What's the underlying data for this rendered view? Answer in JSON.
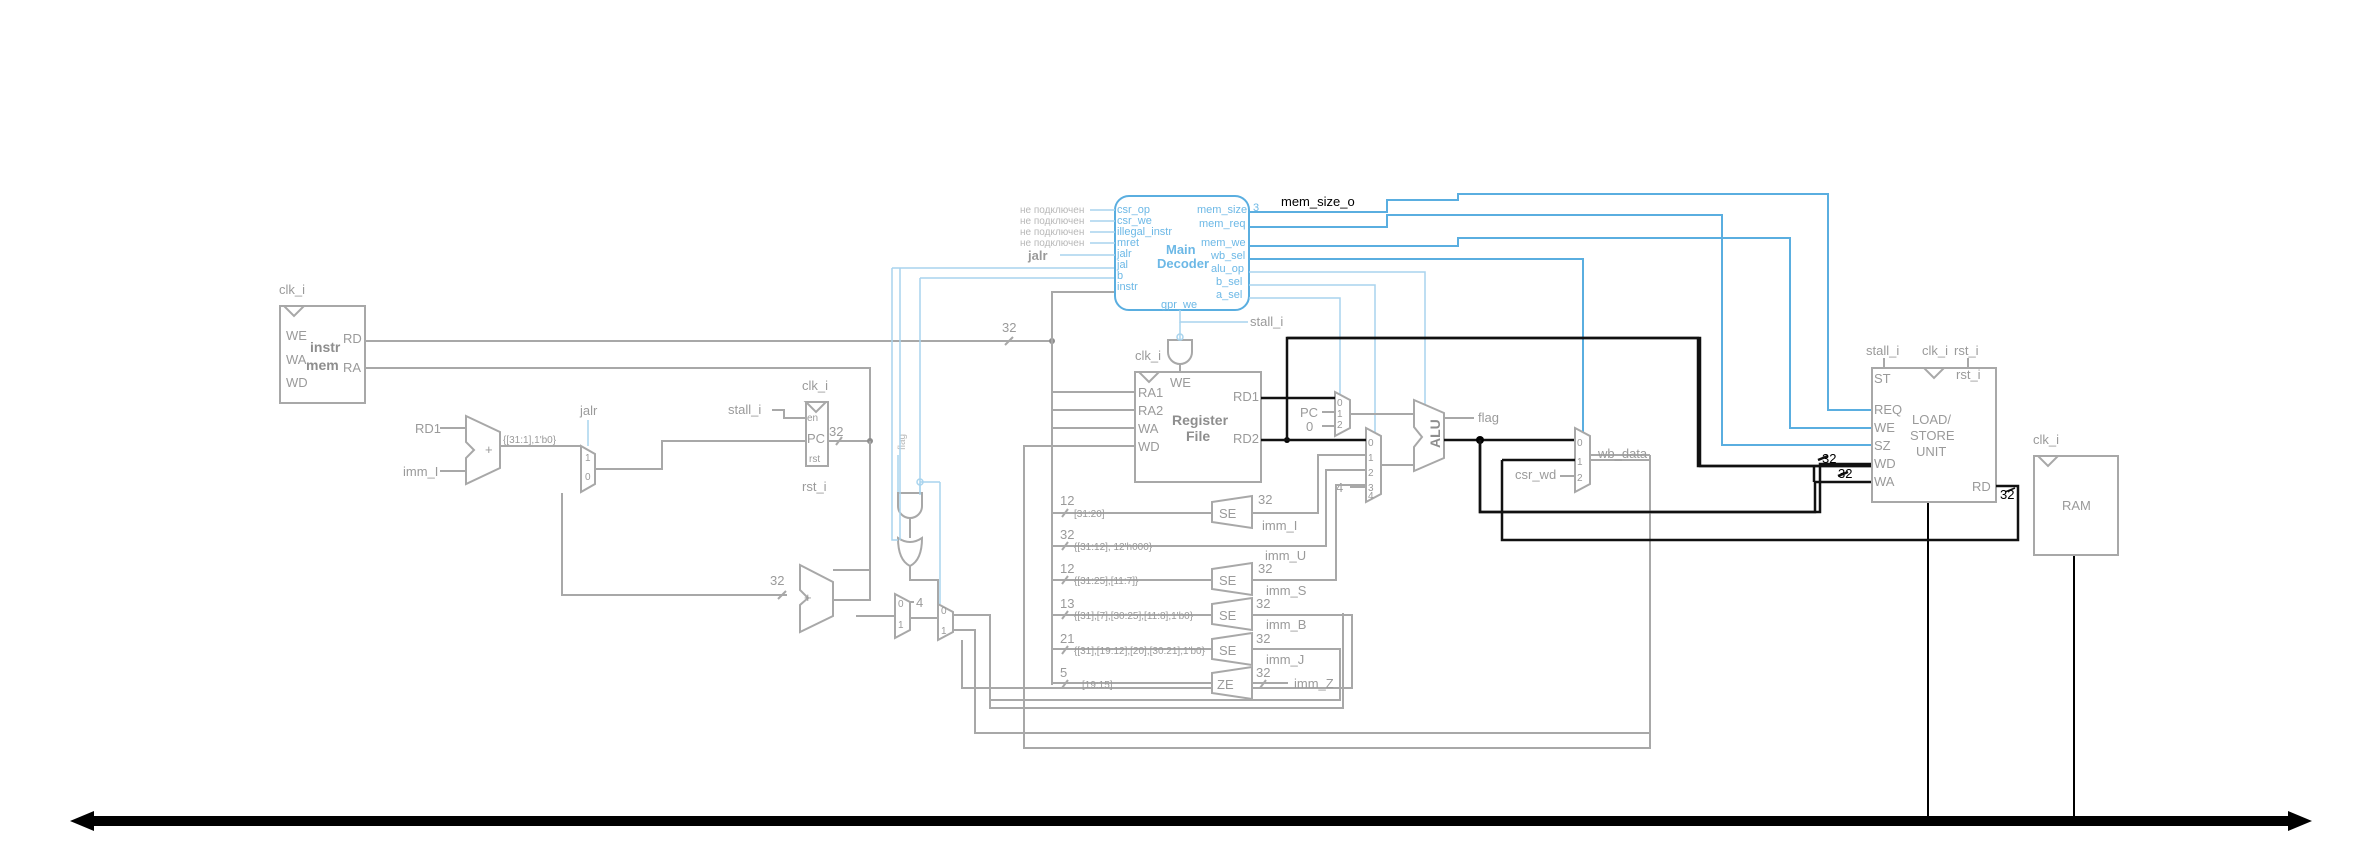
{
  "imem": {
    "clk": "clk_i",
    "port_we": "WE",
    "port_wa": "WA",
    "port_wd": "WD",
    "port_rd": "RD",
    "port_ra": "RA",
    "title_line1": "instr",
    "title_line2": "mem"
  },
  "instr_bus_width": "32",
  "pc_path": {
    "in_rd1": "RD1",
    "in_imm_i": "imm_I",
    "slice": "{[31:1],1'b0}",
    "jalr": "jalr",
    "mux_0": "0",
    "mux_1": "1",
    "stall": "stall_i",
    "clk": "clk_i",
    "pc_label": "PC",
    "en": "en",
    "rst_port": "rst",
    "rst": "rst_i",
    "pc_width": "32",
    "adder_width": "32",
    "four": "4",
    "zero": "0",
    "one": "1"
  },
  "flag_label": "flag",
  "decoder": {
    "title_line1": "Main",
    "title_line2": "Decoder",
    "not_connected": "не подключен",
    "inputs": [
      "csr_op",
      "csr_we",
      "illegal_instr",
      "mret",
      "jalr",
      "jal",
      "b",
      "instr"
    ],
    "outputs": [
      "mem_size",
      "mem_req",
      "mem_we",
      "wb_sel",
      "alu_op",
      "b_sel",
      "a_sel"
    ],
    "bottom": "gpr_we",
    "jalr_wire": "jalr",
    "mem_size_width": "3"
  },
  "mem_size_o": "mem_size_o",
  "regfile": {
    "stall": "stall_i",
    "clk": "clk_i",
    "we": "WE",
    "ra1": "RA1",
    "ra2": "RA2",
    "wa": "WA",
    "wd": "WD",
    "rd1": "RD1",
    "rd2": "RD2",
    "title_line1": "Register",
    "title_line2": "File"
  },
  "alu": {
    "label": "ALU",
    "flag": "flag",
    "pc": "PC",
    "zero": "0",
    "one": "1",
    "two": "2",
    "three": "3",
    "four": "4"
  },
  "imm": [
    {
      "width": "12",
      "slice": "[31:20]",
      "ext": "SE",
      "out_width": "32",
      "name": "imm_I"
    },
    {
      "width": "32",
      "slice": "{[31:12], 12'h000}",
      "ext": "",
      "out_width": "",
      "name": "imm_U"
    },
    {
      "width": "12",
      "slice": "{[31:25],[11:7]}",
      "ext": "SE",
      "out_width": "32",
      "name": "imm_S"
    },
    {
      "width": "13",
      "slice": "{[31],[7],[30:25],[11:8],1'b0}",
      "ext": "SE",
      "out_width": "32",
      "name": "imm_B"
    },
    {
      "width": "21",
      "slice": "{[31],[19:12],[20],[30:21],1'b0}",
      "ext": "SE",
      "out_width": "32",
      "name": "imm_J"
    },
    {
      "width": "5",
      "slice": "[19:15]",
      "ext": "ZE",
      "out_width": "32",
      "name": "imm_Z"
    }
  ],
  "wb": {
    "csr_wd": "csr_wd",
    "wb_data": "wb_data",
    "zero": "0",
    "one": "1",
    "two": "2"
  },
  "lsu": {
    "stall": "stall_i",
    "clk": "clk_i",
    "rst": "rst_i",
    "st": "ST",
    "rst_port": "rst_i",
    "req": "REQ",
    "we": "WE",
    "sz": "SZ",
    "wd": "WD",
    "wa": "WA",
    "rd": "RD",
    "title_line1": "LOAD/",
    "title_line2": "STORE",
    "title_line3": "UNIT",
    "w_wd": "32",
    "w_wa": "32",
    "w_rd": "32"
  },
  "ram": {
    "clk": "clk_i",
    "title": "RAM"
  }
}
